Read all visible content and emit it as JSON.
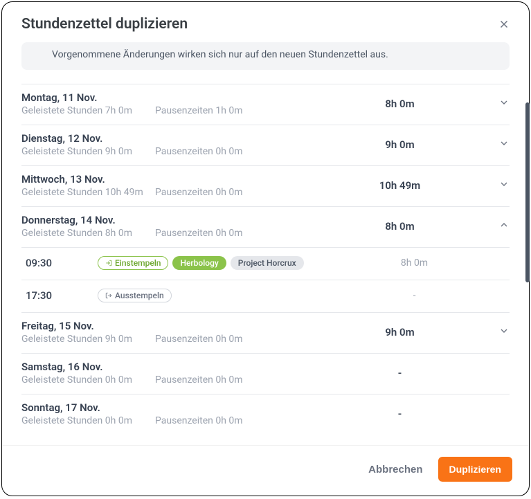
{
  "header": {
    "title": "Stundenzettel duplizieren"
  },
  "banner": {
    "text": "Vorgenommene Änderungen wirken sich nur auf den neuen Stundenzettel aus."
  },
  "labels": {
    "worked_prefix": "Geleistete Stunden",
    "break_prefix": "Pausenzeiten",
    "clock_in": "Einstempeln",
    "clock_out": "Ausstempeln"
  },
  "days": [
    {
      "name": "Montag, 11 Nov.",
      "worked": "7h 0m",
      "break": "1h 0m",
      "total": "8h 0m",
      "expandable": true,
      "expanded": false
    },
    {
      "name": "Dienstag, 12 Nov.",
      "worked": "9h 0m",
      "break": "0h 0m",
      "total": "9h 0m",
      "expandable": true,
      "expanded": false
    },
    {
      "name": "Mittwoch, 13 Nov.",
      "worked": "10h 49m",
      "break": "0h 0m",
      "total": "10h 49m",
      "expandable": true,
      "expanded": false
    },
    {
      "name": "Donnerstag, 14 Nov.",
      "worked": "8h 0m",
      "break": "0h 0m",
      "total": "8h 0m",
      "expandable": true,
      "expanded": true,
      "entries": [
        {
          "time": "09:30",
          "kind": "in",
          "tag1": "Herbology",
          "tag2": "Project Horcrux",
          "duration": "8h 0m"
        },
        {
          "time": "17:30",
          "kind": "out",
          "duration": "-"
        }
      ]
    },
    {
      "name": "Freitag, 15 Nov.",
      "worked": "9h 0m",
      "break": "0h 0m",
      "total": "9h 0m",
      "expandable": true,
      "expanded": false
    },
    {
      "name": "Samstag, 16 Nov.",
      "worked": "0h 0m",
      "break": "0h 0m",
      "total": "-",
      "expandable": false,
      "expanded": false
    },
    {
      "name": "Sonntag, 17 Nov.",
      "worked": "0h 0m",
      "break": "0h 0m",
      "total": "-",
      "expandable": false,
      "expanded": false
    }
  ],
  "footer": {
    "cancel": "Abbrechen",
    "duplicate": "Duplizieren"
  }
}
